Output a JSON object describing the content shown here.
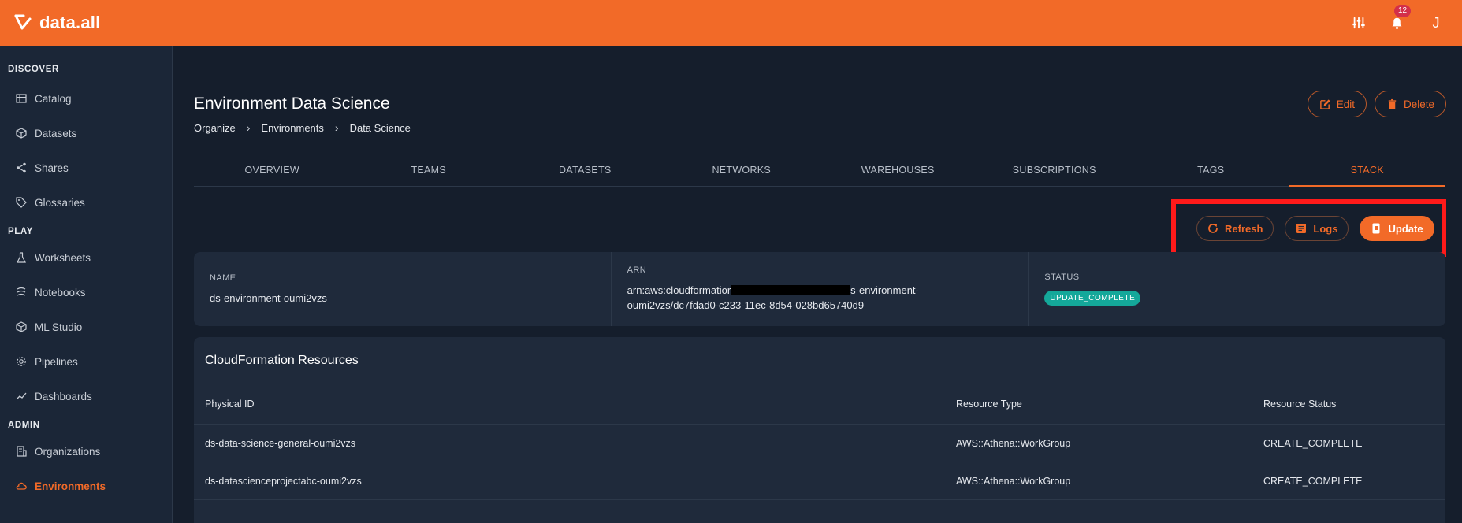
{
  "app": {
    "brand": "data.all",
    "notification_count": "12",
    "avatar_initial": "J"
  },
  "sidebar": {
    "sections": [
      {
        "title": "DISCOVER",
        "items": [
          {
            "label": "Catalog",
            "icon": "catalog-icon"
          },
          {
            "label": "Datasets",
            "icon": "datasets-icon"
          },
          {
            "label": "Shares",
            "icon": "share-icon"
          },
          {
            "label": "Glossaries",
            "icon": "tag-icon"
          }
        ]
      },
      {
        "title": "PLAY",
        "items": [
          {
            "label": "Worksheets",
            "icon": "flask-icon"
          },
          {
            "label": "Notebooks",
            "icon": "notebook-icon"
          },
          {
            "label": "ML Studio",
            "icon": "cube-icon"
          },
          {
            "label": "Pipelines",
            "icon": "gear-icon"
          },
          {
            "label": "Dashboards",
            "icon": "chart-icon"
          }
        ]
      },
      {
        "title": "ADMIN",
        "items": [
          {
            "label": "Organizations",
            "icon": "building-icon"
          },
          {
            "label": "Environments",
            "icon": "cloud-icon",
            "active": true
          }
        ]
      }
    ]
  },
  "page": {
    "title": "Environment Data Science",
    "breadcrumb": [
      "Organize",
      "Environments",
      "Data Science"
    ],
    "edit_label": "Edit",
    "delete_label": "Delete"
  },
  "tabs": [
    "OVERVIEW",
    "TEAMS",
    "DATASETS",
    "NETWORKS",
    "WAREHOUSES",
    "SUBSCRIPTIONS",
    "TAGS",
    "STACK"
  ],
  "active_tab": "STACK",
  "actions": {
    "refresh": "Refresh",
    "logs": "Logs",
    "update": "Update"
  },
  "stack": {
    "name_label": "NAME",
    "name_value": "ds-environment-oumi2vzs",
    "arn_label": "ARN",
    "arn_prefix": "arn:aws:cloudformatior",
    "arn_suffix": "s-environment-",
    "arn_line2": "oumi2vzs/dc7fdad0-c233-11ec-8d54-028bd65740d9",
    "status_label": "STATUS",
    "status_value": "UPDATE_COMPLETE"
  },
  "resources": {
    "title": "CloudFormation Resources",
    "columns": [
      "Physical ID",
      "Resource Type",
      "Resource Status"
    ],
    "rows": [
      [
        "ds-data-science-general-oumi2vzs",
        "AWS::Athena::WorkGroup",
        "CREATE_COMPLETE"
      ],
      [
        "ds-datascienceprojectabc-oumi2vzs",
        "AWS::Athena::WorkGroup",
        "CREATE_COMPLETE"
      ]
    ]
  },
  "colors": {
    "accent": "#f26a28",
    "background": "#151e2c",
    "card": "#1f2a3b",
    "status_green": "#14a89a",
    "highlight": "#ff1a1a"
  }
}
